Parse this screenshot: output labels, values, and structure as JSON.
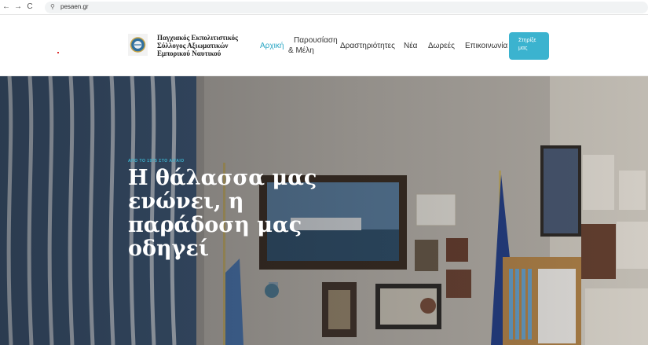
{
  "browser": {
    "back": "←",
    "forward": "→",
    "reload": "C",
    "url_icon": "⚲",
    "url": "pesaen.gr"
  },
  "header": {
    "brand": [
      "Παγχιακός Εκπολιτιστικός",
      "Σύλλογος Αξιωματικών",
      "Εμπορικού Ναυτικού"
    ],
    "nav": {
      "home": "Αρχική",
      "presentation_1": "Παρουσίαση",
      "presentation_2": "& Μέλη",
      "activities": "Δραστηριότητες",
      "news": "Νέα",
      "donations": "Δωρεές",
      "contact": "Επικοινωνία"
    },
    "support_1": "Στηρίξε",
    "support_2": "μας"
  },
  "hero": {
    "eyebrow": "ΑΠΟ ΤΟ 1975 ΣΤΟ ΑΙΓΑΙΟ",
    "headline": [
      "Η θάλασσα μας",
      "ενώνει, η",
      "παράδοση μας",
      "οδηγεί"
    ]
  },
  "colors": {
    "accent": "#3bb3cf",
    "active_link": "#2aa6c4"
  }
}
